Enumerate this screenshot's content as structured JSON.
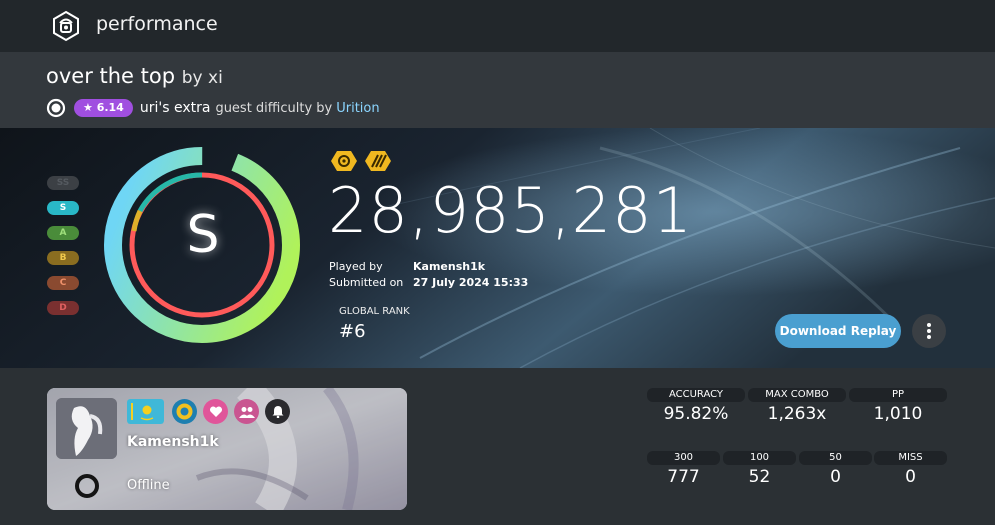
{
  "app": {
    "title": "performance",
    "logo_icon": "osu-lazer-icon"
  },
  "beatmap": {
    "title": "over the top",
    "by_label": "by xi",
    "mode_icon": "osu-mode-icon",
    "star_rating": "★ 6.14",
    "difficulty": "uri's extra",
    "difficulty_suffix": "guest difficulty by",
    "mapper": "Urition"
  },
  "rank_list": [
    {
      "label": "SS",
      "color": "#3c4045",
      "text": "#555a60"
    },
    {
      "label": "S",
      "color": "#29b8c7",
      "text": "#ffffff"
    },
    {
      "label": "A",
      "color": "#4a8c3a",
      "text": "#9fe07c"
    },
    {
      "label": "B",
      "color": "#8a6d20",
      "text": "#f0c94b"
    },
    {
      "label": "C",
      "color": "#8a4a30",
      "text": "#f0916a"
    },
    {
      "label": "D",
      "color": "#7a3030",
      "text": "#e06060"
    }
  ],
  "grade": "S",
  "accuracy_fraction": 0.9582,
  "mods": [
    "hidden-mod-icon",
    "hard-rock-mod-icon"
  ],
  "score": "28,985,281",
  "played_by_label": "Played by",
  "played_by": "Kamensh1k",
  "submitted_on_label": "Submitted on",
  "submitted_on": "27 July 2024 15:33",
  "global_rank_label": "GLOBAL RANK",
  "global_rank": "#6",
  "download_replay": "Download Replay",
  "more_icon": "more-vertical-icon",
  "user": {
    "name": "Kamensh1k",
    "status": "Offline",
    "flag": "kazakhstan-flag-icon",
    "badges": [
      "team-badge-icon",
      "supporter-heart-icon",
      "friends-icon",
      "notification-bell-icon"
    ]
  },
  "stats_top": [
    {
      "label": "ACCURACY",
      "value": "95.82%"
    },
    {
      "label": "MAX COMBO",
      "value": "1,263x"
    },
    {
      "label": "PP",
      "value": "1,010"
    }
  ],
  "stats_bottom": [
    {
      "label": "300",
      "value": "777"
    },
    {
      "label": "100",
      "value": "52"
    },
    {
      "label": "50",
      "value": "0"
    },
    {
      "label": "MISS",
      "value": "0"
    }
  ],
  "colors": {
    "accent": "#4a9fd0",
    "star_badge": "#a04fe0",
    "ring_inner": "#ff5a5a",
    "ring_outer_top": "#6fd6f5",
    "ring_outer_bottom": "#b0f25a"
  }
}
